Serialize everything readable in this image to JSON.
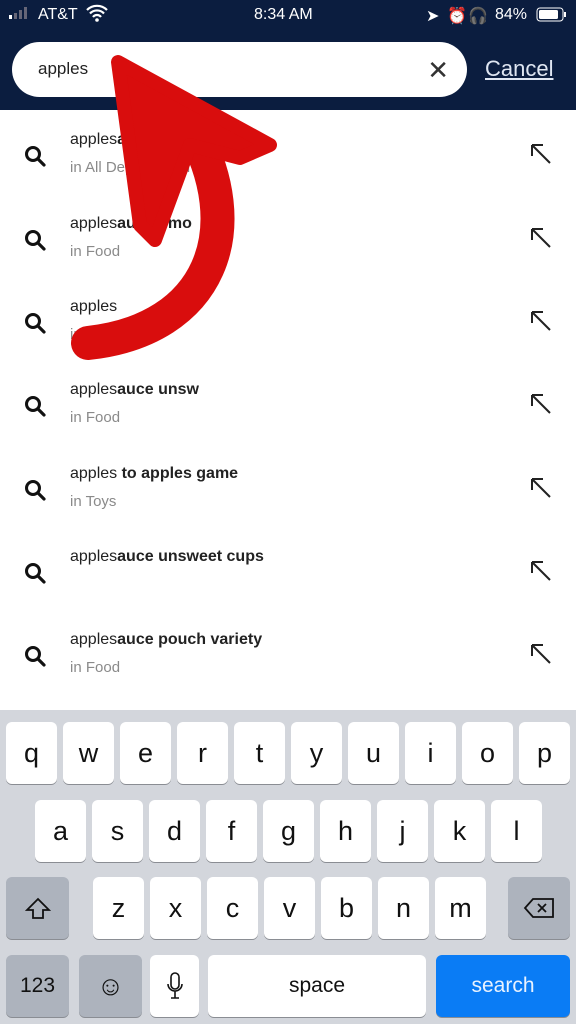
{
  "status_bar": {
    "carrier": "AT&T",
    "time": "8:34 AM",
    "battery": "84%"
  },
  "search": {
    "query": "apples",
    "cancel_label": "Cancel"
  },
  "suggestions": [
    {
      "prefix": "apples",
      "bold": "au",
      "tail": "ts",
      "sub_a": "in All Dep",
      "sub_b": "en"
    },
    {
      "prefix": "apples",
      "bold": "auce - mo",
      "sub": "in Food"
    },
    {
      "prefix": "apples",
      "bold": "",
      "sub": "in"
    },
    {
      "prefix": "apples",
      "bold": "auce unsw",
      "sub": "in Food"
    },
    {
      "prefix": "apples",
      "bold": " to apples game",
      "sub": "in Toys"
    },
    {
      "prefix": "apples",
      "bold": "auce unsweet cups",
      "sub": ""
    },
    {
      "prefix": "apples",
      "bold": "auce pouch variety",
      "sub": "in Food"
    }
  ],
  "keyboard": {
    "row1": [
      "q",
      "w",
      "e",
      "r",
      "t",
      "y",
      "u",
      "i",
      "o",
      "p"
    ],
    "row2": [
      "a",
      "s",
      "d",
      "f",
      "g",
      "h",
      "j",
      "k",
      "l"
    ],
    "row3": [
      "z",
      "x",
      "c",
      "v",
      "b",
      "n",
      "m"
    ],
    "numbers": "123",
    "space": "space",
    "search": "search"
  },
  "colors": {
    "header": "#0b1d3f",
    "accent": "#0a7cf5",
    "annotation": "#d90d0d"
  }
}
